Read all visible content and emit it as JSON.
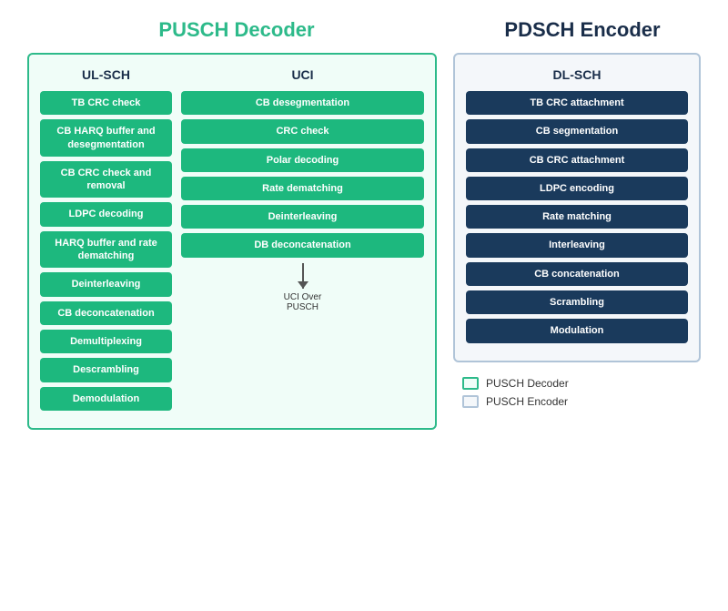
{
  "titles": {
    "pusch": "PUSCH Decoder",
    "pdsch": "PDSCH Encoder"
  },
  "columns": {
    "ul_sch": "UL-SCH",
    "uci": "UCI",
    "dl_sch": "DL-SCH"
  },
  "ul_sch_items": [
    "TB CRC check",
    "CB HARQ buffer and desegmentation",
    "CB CRC check and removal",
    "LDPC decoding",
    "HARQ buffer and rate dematching",
    "Deinterleaving",
    "CB deconcatenation",
    "Demultiplexing",
    "Descrambling",
    "Demodulation"
  ],
  "uci_items": [
    "CB desegmentation",
    "CRC check",
    "Polar decoding",
    "Rate dematching",
    "Deinterleaving",
    "DB deconcatenation"
  ],
  "arrow_label": "UCI Over\nPUSCH",
  "dl_sch_items": [
    "TB CRC attachment",
    "CB segmentation",
    "CB CRC attachment",
    "LDPC encoding",
    "Rate matching",
    "Interleaving",
    "CB concatenation",
    "Scrambling",
    "Modulation"
  ],
  "legend": {
    "pusch_label": "PUSCH Decoder",
    "pdsch_label": "PUSCH Encoder"
  }
}
